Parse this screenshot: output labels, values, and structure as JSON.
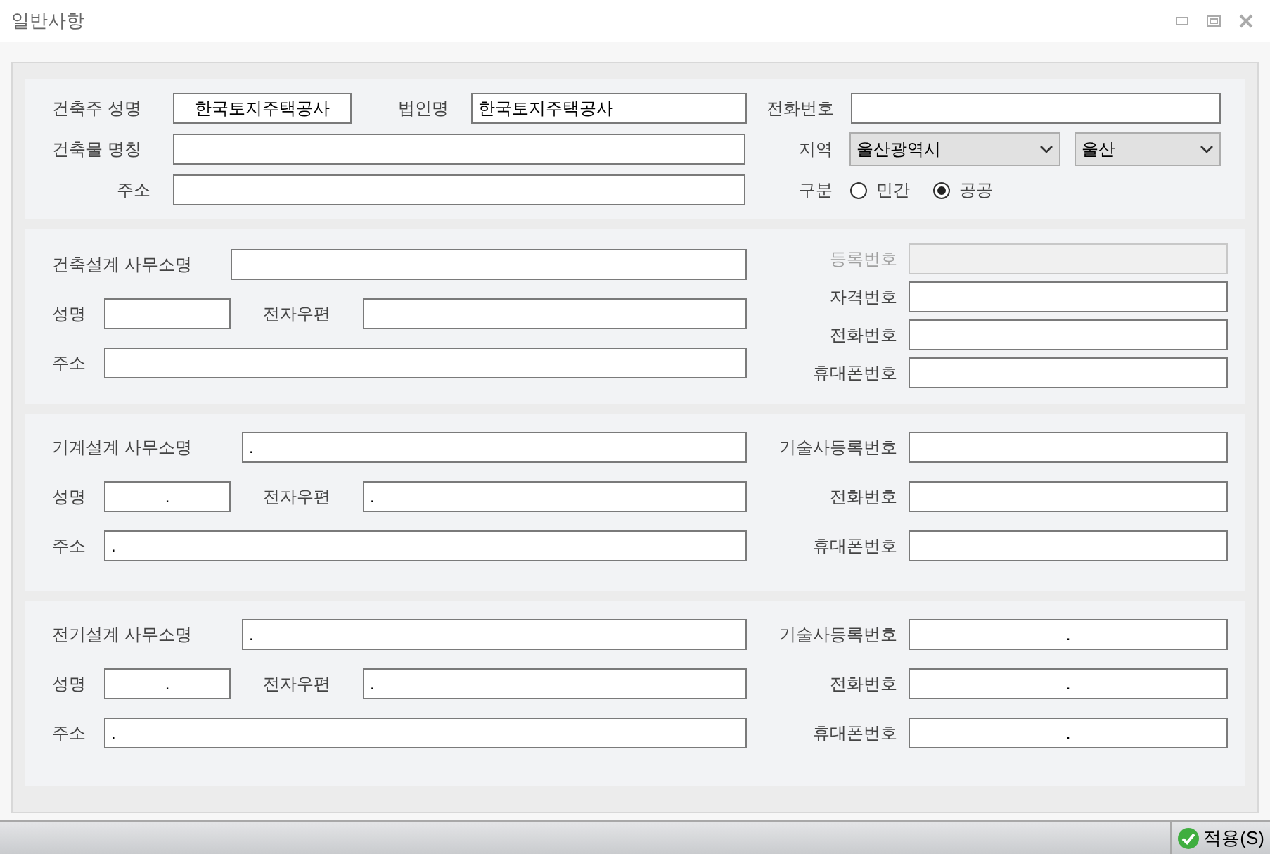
{
  "window": {
    "title": "일반사항"
  },
  "owner_section": {
    "owner_name": {
      "label": "건축주 성명",
      "value": "한국토지주택공사",
      "centered": true
    },
    "corporation": {
      "label": "법인명",
      "value": "한국토지주택공사"
    },
    "phone": {
      "label": "전화번호"
    },
    "building_name": {
      "label": "건축물 명칭"
    },
    "region": {
      "label": "지역",
      "city": "울산광역시",
      "district": "울산"
    },
    "address": {
      "label": "주소"
    },
    "category": {
      "label": "구분",
      "options": [
        {
          "label": "민간",
          "selected": false
        },
        {
          "label": "공공",
          "selected": true
        }
      ]
    }
  },
  "design_sections": [
    {
      "office": {
        "label": "건축설계 사무소명"
      },
      "name": {
        "label": "성명"
      },
      "email": {
        "label": "전자우편"
      },
      "address": {
        "label": "주소"
      },
      "right_fields": [
        {
          "label": "등록번호",
          "disabled": true
        },
        {
          "label": "자격번호",
          "disabled": false
        },
        {
          "label": "전화번호",
          "disabled": false
        },
        {
          "label": "휴대폰번호",
          "disabled": false
        }
      ]
    },
    {
      "office": {
        "label": "기계설계 사무소명",
        "value": "."
      },
      "name": {
        "label": "성명",
        "value": ".",
        "centered": true
      },
      "email": {
        "label": "전자우편",
        "value": "."
      },
      "address": {
        "label": "주소",
        "value": "."
      },
      "right_fields": [
        {
          "label": "기술사등록번호",
          "disabled": false
        },
        {
          "label": "전화번호",
          "disabled": false
        },
        {
          "label": "휴대폰번호",
          "disabled": false
        }
      ]
    },
    {
      "office": {
        "label": "전기설계 사무소명",
        "value": "."
      },
      "name": {
        "label": "성명",
        "value": ".",
        "centered": true
      },
      "email": {
        "label": "전자우편",
        "value": "."
      },
      "address": {
        "label": "주소",
        "value": "."
      },
      "right_fields": [
        {
          "label": "기술사등록번호",
          "value": ".",
          "centered": true,
          "disabled": false
        },
        {
          "label": "전화번호",
          "value": ".",
          "centered": true,
          "disabled": false
        },
        {
          "label": "휴대폰번호",
          "value": ".",
          "centered": true,
          "disabled": false
        }
      ]
    }
  ],
  "status_bar": {
    "apply_button": "적용(S)"
  }
}
